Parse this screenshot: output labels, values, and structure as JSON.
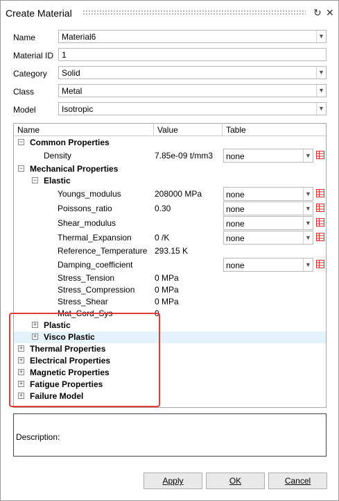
{
  "window": {
    "title": "Create Material"
  },
  "fields": {
    "name": {
      "label": "Name",
      "value": "Material6"
    },
    "material_id": {
      "label": "Material ID",
      "value": "1"
    },
    "category": {
      "label": "Category",
      "value": "Solid"
    },
    "class": {
      "label": "Class",
      "value": "Metal"
    },
    "model": {
      "label": "Model",
      "value": "Isotropic"
    }
  },
  "tree": {
    "columns": {
      "name": "Name",
      "value": "Value",
      "table": "Table"
    },
    "rows": [
      {
        "name": "Common Properties"
      },
      {
        "name": "Density",
        "value": "7.85e-09 t/mm3",
        "table": "none"
      },
      {
        "name": "Mechanical Properties"
      },
      {
        "name": "Elastic"
      },
      {
        "name": "Youngs_modulus",
        "value": "208000 MPa",
        "table": "none"
      },
      {
        "name": "Poissons_ratio",
        "value": "0.30",
        "table": "none"
      },
      {
        "name": "Shear_modulus",
        "table": "none"
      },
      {
        "name": "Thermal_Expansion",
        "value": "0 /K",
        "table": "none"
      },
      {
        "name": "Reference_Temperature",
        "value": "293.15 K"
      },
      {
        "name": "Damping_coefficient",
        "table": "none"
      },
      {
        "name": "Stress_Tension",
        "value": "0 MPa"
      },
      {
        "name": "Stress_Compression",
        "value": "0 MPa"
      },
      {
        "name": "Stress_Shear",
        "value": "0 MPa"
      },
      {
        "name": "Mat_Cord_Sys",
        "value": "0"
      },
      {
        "name": "Plastic"
      },
      {
        "name": "Visco Plastic"
      },
      {
        "name": "Thermal Properties"
      },
      {
        "name": "Electrical Properties"
      },
      {
        "name": "Magnetic Properties"
      },
      {
        "name": "Fatigue Properties"
      },
      {
        "name": "Failure Model"
      }
    ]
  },
  "description": {
    "label": "Description:"
  },
  "buttons": {
    "apply": "Apply",
    "ok": "OK",
    "cancel": "Cancel"
  },
  "colors": {
    "highlight_box": "#e53935",
    "selected_row": "#e4f3fb",
    "table_icon": "#d32f2f"
  },
  "icons": {
    "reset": "refresh-icon",
    "close": "close-icon",
    "expand": "plus-box-icon",
    "collapse": "minus-box-icon",
    "table": "table-icon"
  }
}
